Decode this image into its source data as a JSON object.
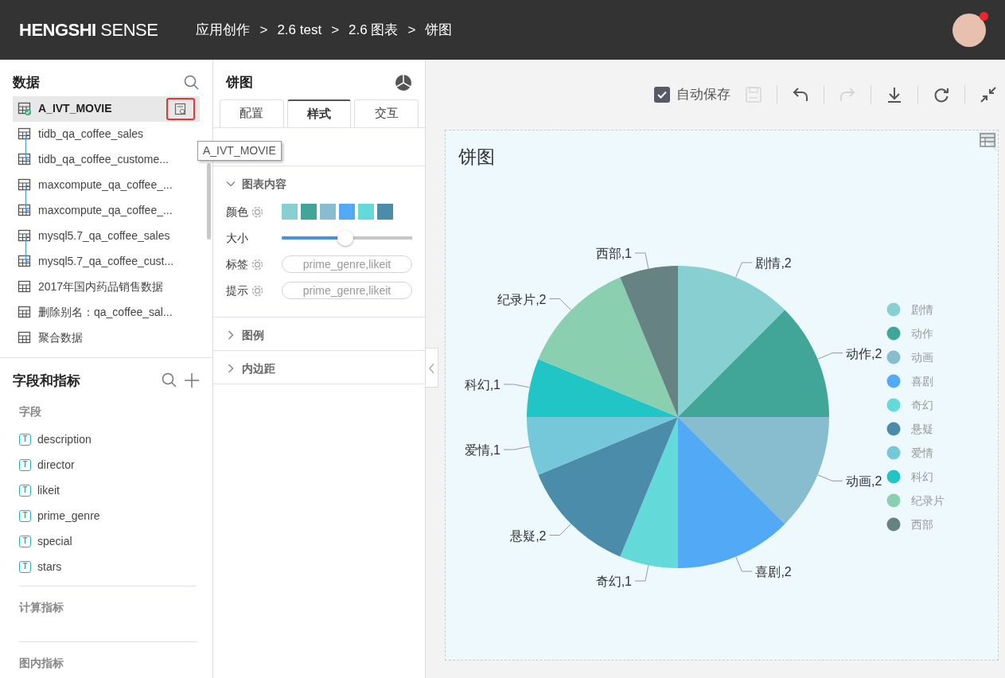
{
  "header": {
    "logo_bold": "HENGSHI",
    "logo_light": "SENSE",
    "breadcrumb": [
      "应用创作",
      "2.6 test",
      "2.6 图表",
      "饼图"
    ],
    "separator": ">"
  },
  "data_panel": {
    "title": "数据",
    "groups": [
      {
        "kind": "single",
        "items": [
          {
            "name": "A_IVT_MOVIE",
            "selected": true,
            "connected": true
          }
        ]
      },
      {
        "kind": "joined",
        "items": [
          {
            "name": "tidb_qa_coffee_sales",
            "selected": false,
            "connected": false
          },
          {
            "name": "tidb_qa_coffee_custome...",
            "selected": false,
            "connected": false
          }
        ]
      },
      {
        "kind": "joined",
        "items": [
          {
            "name": "maxcompute_qa_coffee_...",
            "selected": false,
            "connected": false
          },
          {
            "name": "maxcompute_qa_coffee_...",
            "selected": false,
            "connected": false
          }
        ]
      },
      {
        "kind": "joined",
        "items": [
          {
            "name": "mysql5.7_qa_coffee_sales",
            "selected": false,
            "connected": false
          },
          {
            "name": "mysql5.7_qa_coffee_cust...",
            "selected": false,
            "connected": false
          }
        ]
      },
      {
        "kind": "single",
        "items": [
          {
            "name": "2017年国内药品销售数据",
            "selected": false,
            "connected": false
          }
        ]
      },
      {
        "kind": "single",
        "items": [
          {
            "name": "删除别名：qa_coffee_sal...",
            "selected": false,
            "connected": false
          }
        ]
      },
      {
        "kind": "single",
        "items": [
          {
            "name": "聚合数据",
            "selected": false,
            "connected": false
          }
        ]
      }
    ],
    "tooltip": "A_IVT_MOVIE"
  },
  "fields_panel": {
    "title": "字段和指标",
    "sections": [
      {
        "title": "字段",
        "fields": [
          {
            "type_badge": "T",
            "name": "description"
          },
          {
            "type_badge": "T",
            "name": "director"
          },
          {
            "type_badge": "T",
            "name": "likeit"
          },
          {
            "type_badge": "T",
            "name": "prime_genre"
          },
          {
            "type_badge": "T",
            "name": "special"
          },
          {
            "type_badge": "T",
            "name": "stars"
          }
        ]
      },
      {
        "title": "计算指标"
      },
      {
        "title": "图内指标"
      }
    ]
  },
  "style_panel": {
    "title": "饼图",
    "tabs": [
      {
        "label": "配置",
        "selected": false
      },
      {
        "label": "样式",
        "selected": true
      },
      {
        "label": "交互",
        "selected": false
      }
    ],
    "sections": [
      {
        "title": "图表内容",
        "expanded": true,
        "rows": [
          {
            "kind": "colors",
            "label": "颜色",
            "colors": [
              {
                "color": "#88cfd2"
              },
              {
                "color": "#41a597"
              },
              {
                "color": "#87bdcf"
              },
              {
                "color": "#52a9f5"
              },
              {
                "color": "#64d9da"
              },
              {
                "color": "#4a8caa"
              }
            ]
          },
          {
            "kind": "slider",
            "label": "大小",
            "level": 0.49
          },
          {
            "kind": "pill",
            "label": "标签",
            "value": "prime_genre,likeit"
          },
          {
            "kind": "pill",
            "label": "提示",
            "value": "prime_genre,likeit"
          }
        ]
      },
      {
        "title": "图例",
        "expanded": false
      },
      {
        "title": "内边距",
        "expanded": false
      }
    ]
  },
  "toolbar": {
    "autosave": {
      "label": "自动保存",
      "checked": true
    },
    "buttons": [
      {
        "kind": "save",
        "disabled": true
      },
      {
        "kind": "undo",
        "disabled": false
      },
      {
        "kind": "redo",
        "disabled": true
      },
      {
        "kind": "download",
        "disabled": false
      },
      {
        "kind": "refresh",
        "disabled": false
      },
      {
        "kind": "collapse",
        "disabled": false
      }
    ]
  },
  "chart": {
    "title": "饼图",
    "slices": [
      {
        "color": "#88cfd2"
      },
      {
        "color": "#41a597"
      },
      {
        "color": "#87bdcf"
      },
      {
        "color": "#52a9f5"
      },
      {
        "color": "#64d9da"
      },
      {
        "color": "#4a8caa"
      },
      {
        "color": "#74c8da"
      },
      {
        "color": "#22c5c6"
      },
      {
        "color": "#89cfb0"
      },
      {
        "color": "#678282"
      }
    ],
    "chart_data": {
      "type": "pie",
      "legend": "right",
      "categories": [
        "剧情",
        "动作",
        "动画",
        "喜剧",
        "奇幻",
        "悬疑",
        "爱情",
        "科幻",
        "纪录片",
        "西部"
      ],
      "values": [
        2,
        2,
        2,
        2,
        1,
        2,
        1,
        1,
        2,
        1
      ],
      "value_labels": [
        "剧情,2",
        "动作,2",
        "动画,2",
        "喜剧,2",
        "奇幻,1",
        "悬疑,2",
        "爱情,1",
        "科幻,1",
        "纪录片,2",
        "西部,1"
      ]
    }
  }
}
